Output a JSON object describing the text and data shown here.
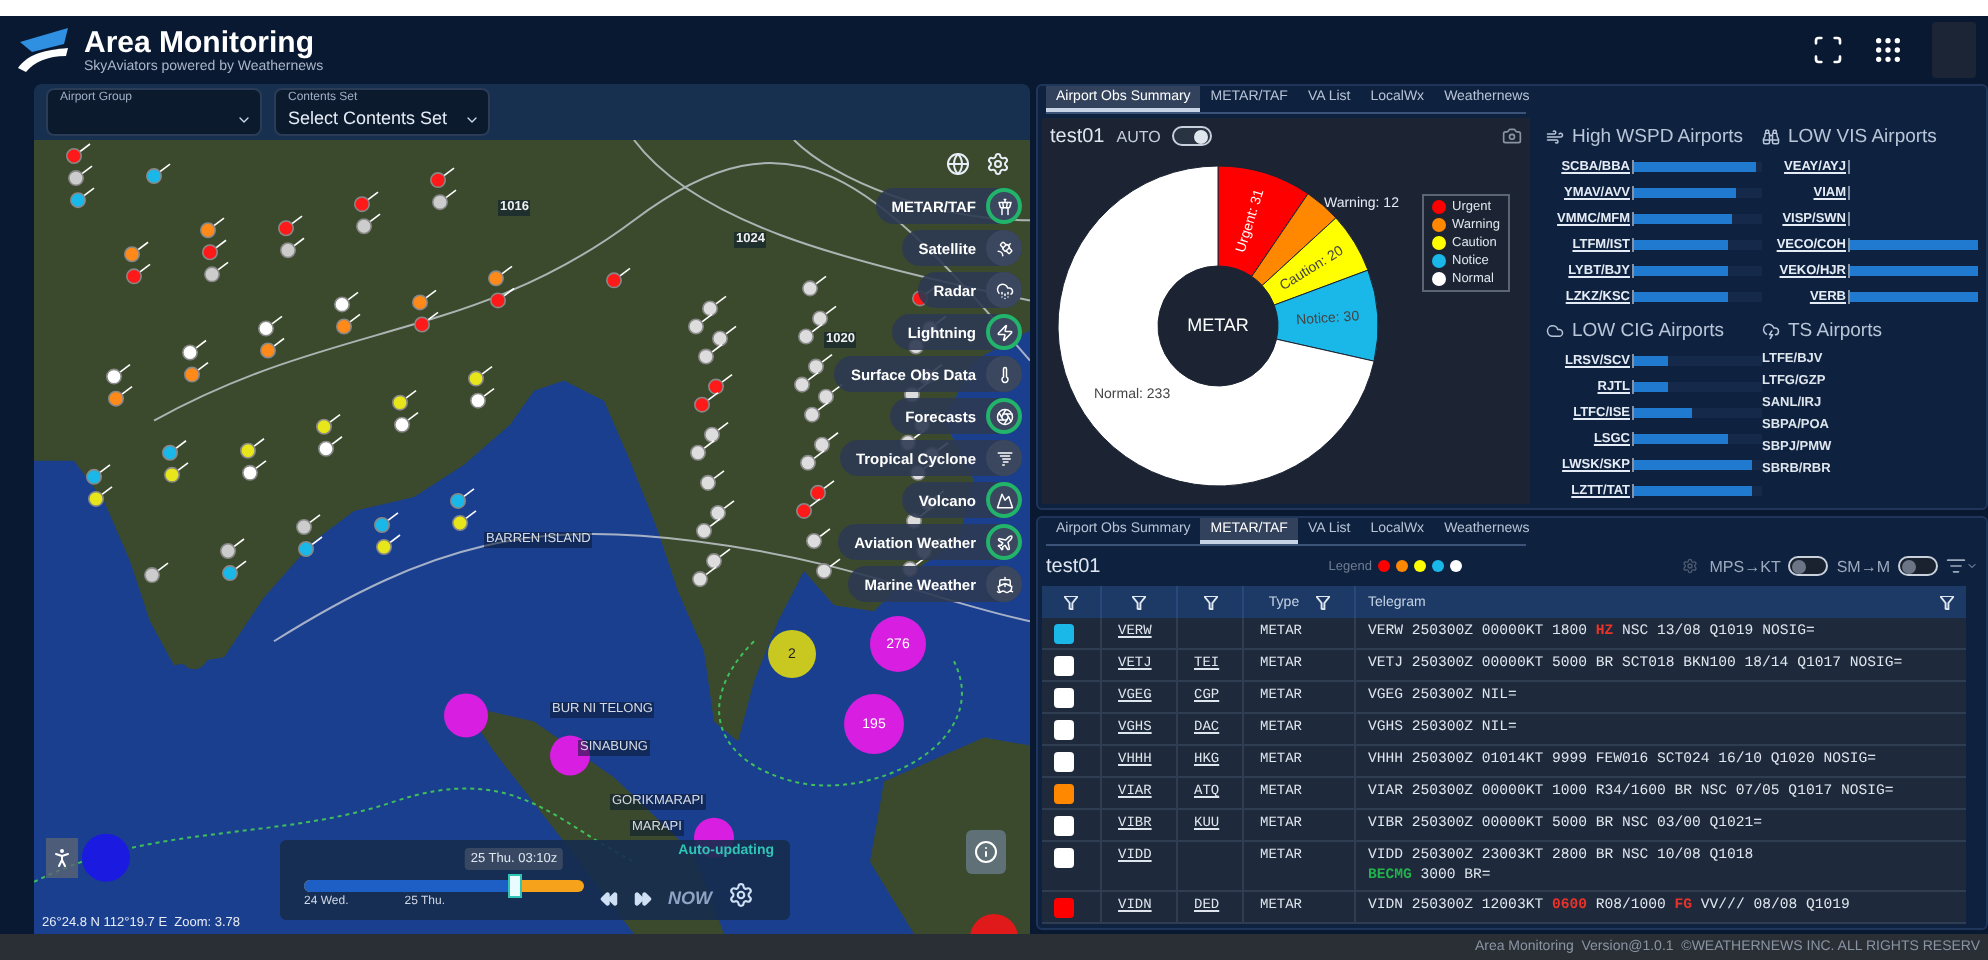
{
  "app": {
    "title": "Area Monitoring",
    "subtitle": "SkyAviators powered by Weathernews"
  },
  "selectors": [
    {
      "label": "Airport Group"
    },
    {
      "label": "Contents Set",
      "value": "Select Contents Set"
    }
  ],
  "map": {
    "layers": [
      {
        "label": "METAR/TAF",
        "kind": "tower",
        "on": true
      },
      {
        "label": "Satellite",
        "kind": "satellite",
        "on": false
      },
      {
        "label": "Radar",
        "kind": "radar",
        "on": false
      },
      {
        "label": "Lightning",
        "kind": "lightning",
        "on": true
      },
      {
        "label": "Surface Obs Data",
        "kind": "thermo",
        "on": false
      },
      {
        "label": "Forecasts",
        "kind": "forecast",
        "on": true
      },
      {
        "label": "Tropical Cyclone",
        "kind": "cyclone",
        "on": false
      },
      {
        "label": "Volcano",
        "kind": "volcano",
        "on": true
      },
      {
        "label": "Aviation Weather",
        "kind": "aviation",
        "on": true
      },
      {
        "label": "Marine Weather",
        "kind": "marine",
        "on": false
      }
    ],
    "labels": [
      {
        "text": "1016",
        "kind": "isobar"
      },
      {
        "text": "1024",
        "kind": "isobar"
      },
      {
        "text": "1020",
        "kind": "isobar"
      },
      {
        "text": "BARREN ISLAND",
        "kind": "place"
      },
      {
        "text": "BUR NI TELONG",
        "kind": "place"
      },
      {
        "text": "SINABUNG",
        "kind": "place"
      },
      {
        "text": "GORIKMARAPI",
        "kind": "place"
      },
      {
        "text": "MARAPI",
        "kind": "place"
      }
    ],
    "clusters": [
      {
        "count": "276",
        "color": "#d81ee0"
      },
      {
        "count": "2",
        "color": "#c8c820"
      },
      {
        "count": "195",
        "color": "#d81ee0"
      }
    ],
    "timeline": {
      "time": "25 Thu. 03:10z",
      "status": "Auto-updating",
      "level": 0.75,
      "day_labels": [
        "24 Wed.",
        "25 Thu."
      ],
      "now_label": "NOW"
    },
    "coordinates": "26°24.8 N 112°19.7 E  Zoom: 3.78"
  },
  "summary_panel": {
    "tabs": [
      {
        "label": "Airport Obs Summary",
        "selected": true
      },
      {
        "label": "METAR/TAF",
        "selected": false
      },
      {
        "label": "VA List",
        "selected": false
      },
      {
        "label": "LocalWx",
        "selected": false
      },
      {
        "label": "Weathernews",
        "selected": false
      }
    ],
    "name": "test01",
    "auto_label": "AUTO",
    "auto": true,
    "legend": [
      {
        "label": "Urgent",
        "color": "#ff0000"
      },
      {
        "label": "Warning",
        "color": "#ff8800"
      },
      {
        "label": "Caution",
        "color": "#ffff00"
      },
      {
        "label": "Notice",
        "color": "#1ab8e8"
      },
      {
        "label": "Normal",
        "color": "#ffffff"
      }
    ],
    "chart_data": {
      "type": "donut",
      "title": "METAR",
      "values": [
        31,
        12,
        20,
        30,
        233
      ],
      "value_labels": [
        "Urgent: 31",
        "Warning: 12",
        "Caution: 20",
        "Notice: 30",
        "Normal: 233"
      ]
    },
    "sections": [
      {
        "title": "High WSPD Airports",
        "kind": "wind",
        "items": [
          {
            "code": "SCBA/BBA",
            "level": 0.95
          },
          {
            "code": "YMAV/AVV",
            "level": 0.8
          },
          {
            "code": "VMMC/MFM",
            "level": 0.77
          },
          {
            "code": "LTFM/IST",
            "level": 0.73
          },
          {
            "code": "LYBT/BJY",
            "level": 0.73
          },
          {
            "code": "LZKZ/KSC",
            "level": 0.73
          }
        ]
      },
      {
        "title": "LOW VIS Airports",
        "kind": "binoculars",
        "items": [
          {
            "code": "VEAY/AYJ"
          },
          {
            "code": "VIAM"
          },
          {
            "code": "VISP/SWN"
          },
          {
            "code": "VECO/COH",
            "level": 1
          },
          {
            "code": "VEKO/HJR",
            "level": 1
          },
          {
            "code": "VERB",
            "level": 1
          }
        ]
      },
      {
        "title": "LOW CIG Airports",
        "kind": "cloud",
        "items": [
          {
            "code": "LRSV/SCV",
            "level": 0.27
          },
          {
            "code": "RJTL",
            "level": 0.27
          },
          {
            "code": "LTFC/ISE",
            "level": 0.45
          },
          {
            "code": "LSGC",
            "level": 0.73
          },
          {
            "code": "LWSK/SKP",
            "level": 0.92
          },
          {
            "code": "LZTT/TAT",
            "level": 0.92
          }
        ]
      },
      {
        "title": "TS Airports",
        "kind": "storm",
        "items": [
          {
            "code": "LTFE/BJV"
          },
          {
            "code": "LTFG/GZP"
          },
          {
            "code": "SANL/IRJ"
          },
          {
            "code": "SBPA/POA"
          },
          {
            "code": "SBPJ/PMW"
          },
          {
            "code": "SBRB/RBR"
          }
        ]
      }
    ]
  },
  "metar_panel": {
    "tabs": [
      {
        "label": "Airport Obs Summary",
        "selected": false
      },
      {
        "label": "METAR/TAF",
        "selected": true
      },
      {
        "label": "VA List",
        "selected": false
      },
      {
        "label": "LocalWx",
        "selected": false
      },
      {
        "label": "Weathernews",
        "selected": false
      }
    ],
    "name": "test01",
    "legend_label": "Legend",
    "legend": [
      {
        "color": "#ff0000"
      },
      {
        "color": "#ff8800"
      },
      {
        "color": "#ffff00"
      },
      {
        "color": "#1ab8e8"
      },
      {
        "color": "#ffffff"
      }
    ],
    "toggles": [
      {
        "label": "MPS→KT",
        "on": false
      },
      {
        "label": "SM→M",
        "on": false
      }
    ],
    "table": {
      "columns": [
        {
          "filter": true
        },
        {
          "filter": true
        },
        {
          "filter": true
        },
        {
          "label": "Type",
          "filter": true
        },
        {
          "label": "Telegram",
          "filter": true
        }
      ],
      "rows": [
        {
          "color": "#1ab8e8",
          "icao": "VERW",
          "type": "METAR",
          "telegram": [
            [
              {
                "text": "VERW 250300Z 00000KT 1800 "
              },
              {
                "text": "HZ",
                "color": "#e8322a"
              },
              {
                "text": " NSC 13/08 Q1019 NOSIG="
              }
            ]
          ]
        },
        {
          "color": "#ffffff",
          "icao": "VETJ",
          "iata": "TEI",
          "type": "METAR",
          "telegram": [
            [
              {
                "text": "VETJ 250300Z 00000KT 5000 BR SCT018 BKN100 18/14 Q1017 NOSIG="
              }
            ]
          ]
        },
        {
          "color": "#ffffff",
          "icao": "VGEG",
          "iata": "CGP",
          "type": "METAR",
          "telegram": [
            [
              {
                "text": "VGEG 250300Z NIL="
              }
            ]
          ]
        },
        {
          "color": "#ffffff",
          "icao": "VGHS",
          "iata": "DAC",
          "type": "METAR",
          "telegram": [
            [
              {
                "text": "VGHS 250300Z NIL="
              }
            ]
          ]
        },
        {
          "color": "#ffffff",
          "icao": "VHHH",
          "iata": "HKG",
          "type": "METAR",
          "telegram": [
            [
              {
                "text": "VHHH 250300Z 01014KT 9999 FEW016 SCT024 16/10 Q1020 NOSIG="
              }
            ]
          ]
        },
        {
          "color": "#ff8800",
          "icao": "VIAR",
          "iata": "ATQ",
          "type": "METAR",
          "telegram": [
            [
              {
                "text": "VIAR 250300Z 00000KT 1000 R34/1600 BR NSC 07/05 Q1017 NOSIG="
              }
            ]
          ]
        },
        {
          "color": "#ffffff",
          "icao": "VIBR",
          "iata": "KUU",
          "type": "METAR",
          "telegram": [
            [
              {
                "text": "VIBR 250300Z 00000KT 5000 BR NSC 03/00 Q1021="
              }
            ]
          ]
        },
        {
          "color": "#ffffff",
          "icao": "VIDD",
          "type": "METAR",
          "telegram": [
            [
              {
                "text": "VIDD 250300Z 23003KT 2800 BR NSC 10/08 Q1018"
              }
            ],
            [
              {
                "text": "BECMG",
                "color": "#22b04a"
              },
              {
                "text": " 3000 BR="
              }
            ]
          ]
        },
        {
          "color": "#ff0000",
          "icao": "VIDN",
          "iata": "DED",
          "type": "METAR",
          "telegram": [
            [
              {
                "text": "VIDN 250300Z 12003KT "
              },
              {
                "text": "0600",
                "color": "#e8322a"
              },
              {
                "text": " R08/1000 "
              },
              {
                "text": "FG",
                "color": "#e8322a"
              },
              {
                "text": " VV/// 08/08 Q1019"
              }
            ]
          ]
        }
      ]
    }
  },
  "footer": "Area Monitoring  Version@1.0.1  ©WEATHERNEWS INC. ALL RIGHTS RESERV"
}
